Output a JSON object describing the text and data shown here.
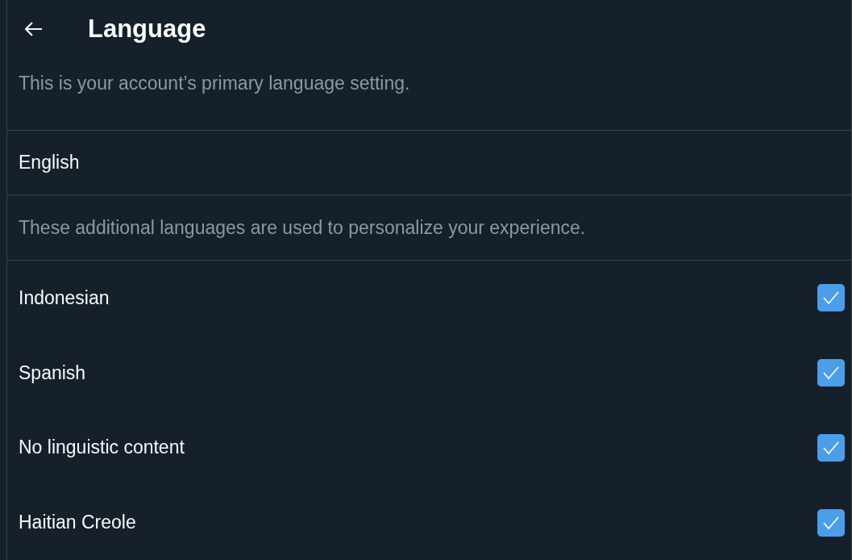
{
  "header": {
    "title": "Language"
  },
  "primary_note": "This is your account’s primary language setting.",
  "primary_language": "English",
  "additional_note": "These additional languages are used to personalize your experience.",
  "languages": [
    {
      "label": "Indonesian",
      "checked": true
    },
    {
      "label": "Spanish",
      "checked": true
    },
    {
      "label": "No linguistic content",
      "checked": true
    },
    {
      "label": "Haitian Creole",
      "checked": true
    }
  ]
}
